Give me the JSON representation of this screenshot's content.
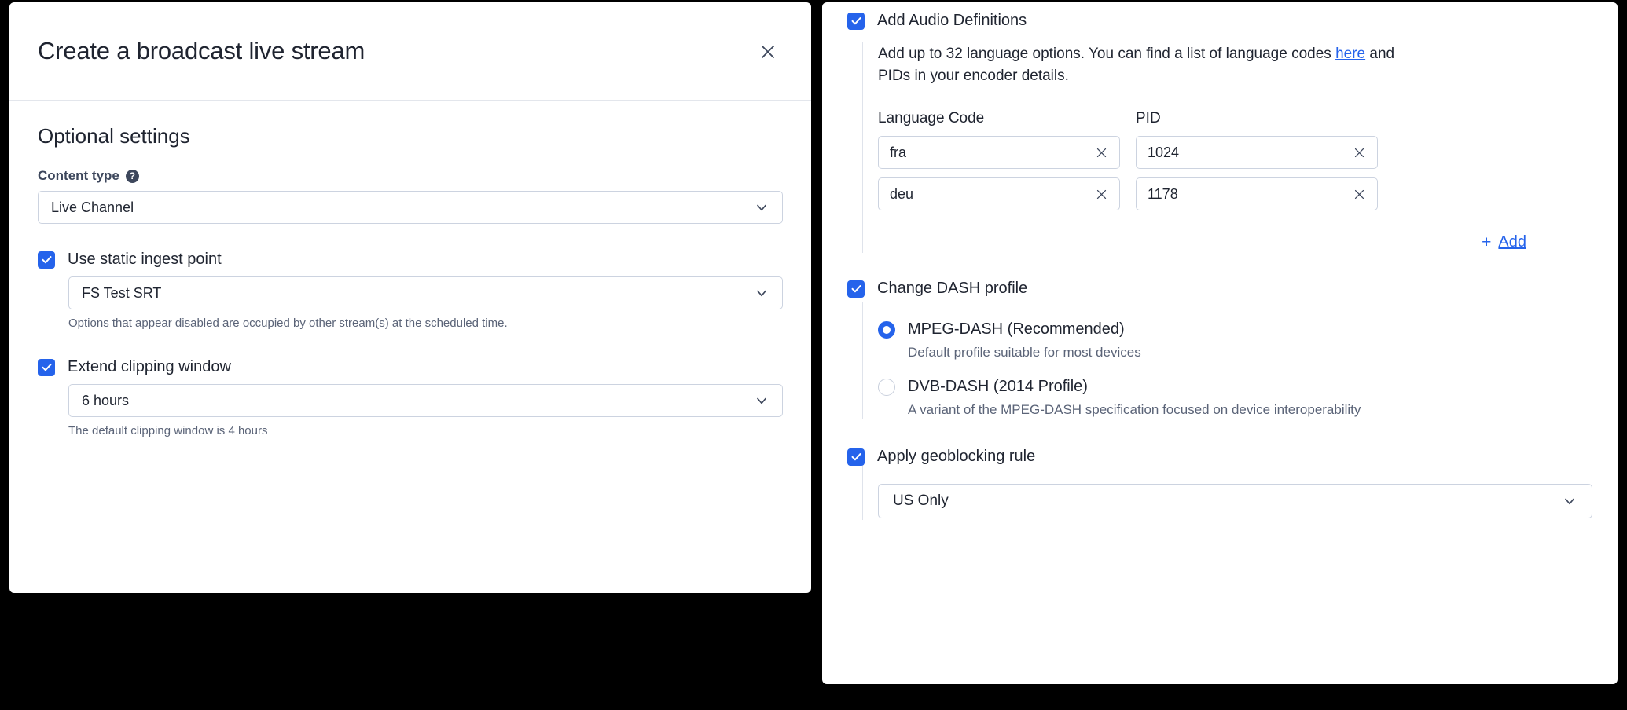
{
  "left_modal": {
    "title": "Create a broadcast live stream",
    "close_icon": "close-icon",
    "section_heading": "Optional settings",
    "content_type": {
      "label": "Content type",
      "help_icon": "help-circle-icon",
      "value": "Live Channel",
      "chevron_icon": "chevron-down-icon"
    },
    "static_ingest": {
      "checkbox_label": "Use static ingest point",
      "checked": true,
      "value": "FS Test SRT",
      "chevron_icon": "chevron-down-icon",
      "hint": "Options that appear disabled are occupied by other stream(s) at the scheduled time."
    },
    "clipping_window": {
      "checkbox_label": "Extend clipping window",
      "checked": true,
      "value": "6 hours",
      "chevron_icon": "chevron-down-icon",
      "hint": "The default clipping window is 4 hours"
    }
  },
  "right_panel": {
    "audio_definitions": {
      "checkbox_label": "Add Audio Definitions",
      "checked": true,
      "description_part1": "Add up to 32 language options. You can find a list of language codes ",
      "description_link": "here",
      "description_part2": " and PIDs in your encoder details.",
      "columns": [
        "Language Code",
        "PID"
      ],
      "rows": [
        {
          "language_code": "fra",
          "pid": "1024"
        },
        {
          "language_code": "deu",
          "pid": "1178"
        }
      ],
      "clear_icon": "close-icon",
      "add_plus": "+",
      "add_label": "Add"
    },
    "dash_profile": {
      "checkbox_label": "Change DASH profile",
      "checked": true,
      "options": [
        {
          "label": "MPEG-DASH (Recommended)",
          "description": "Default profile suitable for most devices",
          "selected": true
        },
        {
          "label": "DVB-DASH (2014 Profile)",
          "description": "A variant of the MPEG-DASH specification focused on device interoperability",
          "selected": false
        }
      ]
    },
    "geoblocking": {
      "checkbox_label": "Apply geoblocking rule",
      "checked": true,
      "value": "US Only",
      "chevron_icon": "chevron-down-icon"
    }
  },
  "colors": {
    "accent_blue": "#2563eb",
    "link_blue": "#2563eb",
    "text_dark": "#1f2430",
    "text_muted": "#5b6478",
    "border": "#ccd3e0",
    "backdrop": "#000000"
  }
}
